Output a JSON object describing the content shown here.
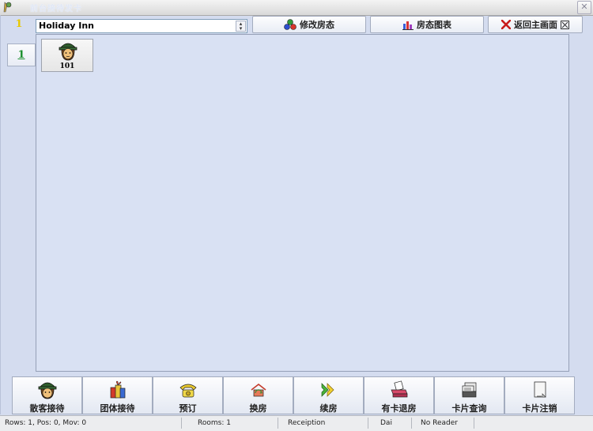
{
  "window": {
    "title": "前台接待发卡",
    "close_label": "✕"
  },
  "side": {
    "floor_marker": "1",
    "floor_button": "1"
  },
  "hotel": {
    "selected": "Holiday Inn"
  },
  "toolbar": {
    "modify_status": "修改房态",
    "status_chart": "房态图表",
    "return_main": "返回主画面"
  },
  "rooms": [
    {
      "number": "101"
    }
  ],
  "actions": {
    "walkin": "散客接待",
    "group": "团体接待",
    "reserve": "预订",
    "change_room": "换房",
    "extend": "续房",
    "checkout_card": "有卡退房",
    "card_query": "卡片查询",
    "card_cancel": "卡片注销"
  },
  "status": {
    "position": "Rows: 1, Pos: 0, Mov: 0",
    "rooms": "Rooms:  1",
    "module": "Receiption",
    "user": "Dai",
    "reader": "No Reader"
  },
  "colors": {
    "background": "#d4dcef",
    "panel": "#d9e1f3",
    "accent_green": "#1a8f2d",
    "marker_yellow": "#e8c800"
  }
}
